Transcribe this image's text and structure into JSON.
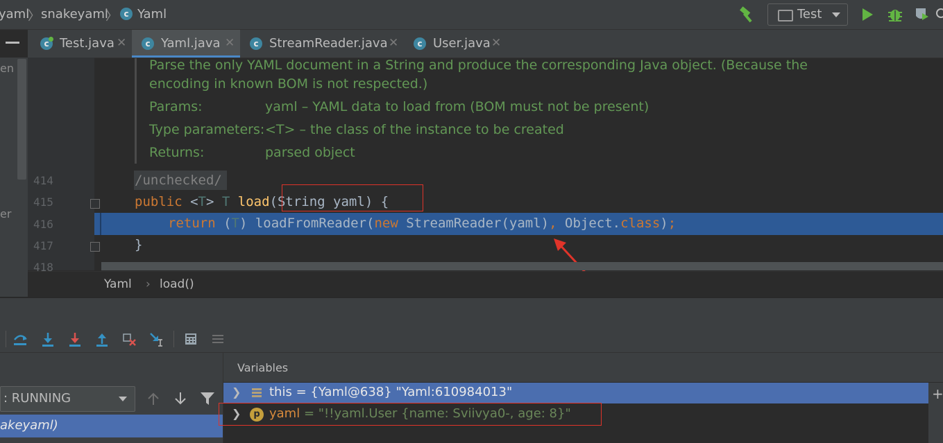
{
  "navbar": {
    "breadcrumb": [
      "yaml",
      "snakeyaml",
      "Yaml"
    ],
    "run_config": "Test"
  },
  "tabs": [
    {
      "label": "Test.java"
    },
    {
      "label": "Yaml.java"
    },
    {
      "label": "StreamReader.java"
    },
    {
      "label": "User.java"
    }
  ],
  "left_panel": {
    "frag_top": "en",
    "frag_mid": "er"
  },
  "doc": {
    "line1": "Parse the only YAML document in a String and produce the corresponding Java object. (Because the",
    "line2": "encoding in known BOM is not respected.)",
    "params_label": "Params:",
    "params_value": "yaml – YAML data to load from (BOM must not be present)",
    "type_label": "Type parameters:",
    "type_value": "<T> – the class of the instance to be created",
    "returns_label": "Returns:",
    "returns_value": "parsed object"
  },
  "code": {
    "line_numbers": [
      "414",
      "415",
      "416",
      "417",
      "418"
    ],
    "unchecked": "/unchecked/"
  },
  "breadcrumbs": [
    "Yaml",
    "load()"
  ],
  "debug": {
    "variables_title": "Variables",
    "thread": ": RUNNING",
    "frame": "akeyaml)",
    "vars": [
      {
        "name": "this",
        "value": " = {Yaml@638} \"Yaml:610984013\""
      },
      {
        "name": "yaml",
        "value": " = \"!!yaml.User {name: Sviivya0-, age: 8}\""
      }
    ]
  }
}
